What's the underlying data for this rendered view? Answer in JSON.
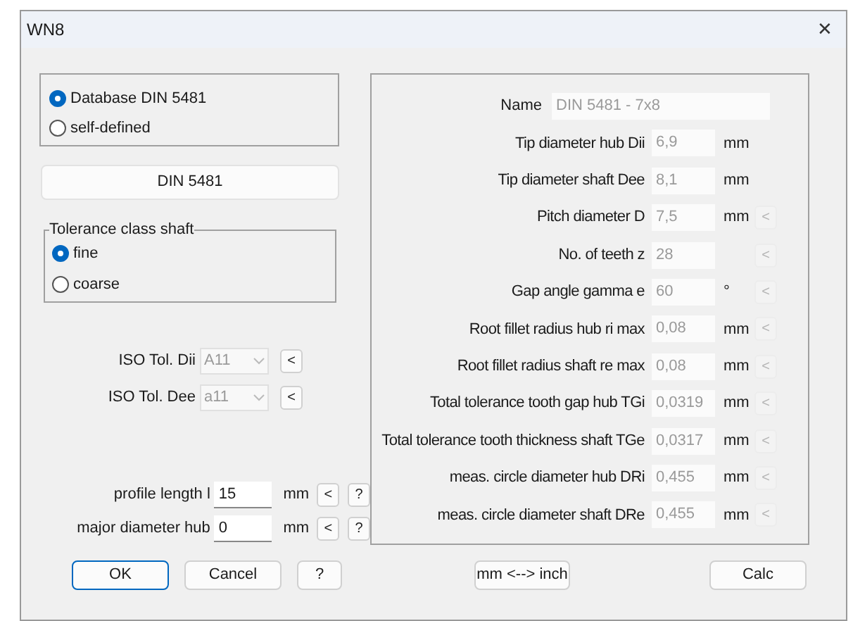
{
  "window": {
    "title": "WN8",
    "close": "✕"
  },
  "source": [
    {
      "label": "Database DIN 5481",
      "selected": true
    },
    {
      "label": "self-defined",
      "selected": false
    }
  ],
  "standard_button": "DIN 5481",
  "tolerance_class": {
    "title": "Tolerance class shaft",
    "options": [
      {
        "label": "fine",
        "selected": true
      },
      {
        "label": "coarse",
        "selected": false
      }
    ]
  },
  "iso_tolerances": [
    {
      "label": "ISO Tol. Dii",
      "value": "A11",
      "disabled": true,
      "button": "<"
    },
    {
      "label": "ISO Tol. Dee",
      "value": "a11",
      "disabled": true,
      "button": "<"
    }
  ],
  "length_fields": [
    {
      "label": "profile length l",
      "value": "15",
      "unit": "mm",
      "button": "<",
      "help": "?"
    },
    {
      "label": "major diameter hub",
      "value": "0",
      "unit": "mm",
      "button": "<",
      "help": "?"
    }
  ],
  "parameters": [
    {
      "label": "Name",
      "value": "DIN 5481 - 7x8",
      "disabled": true,
      "kind": "wide"
    },
    {
      "label": "Tip diameter hub Dii",
      "value": "6,9",
      "unit": "mm",
      "disabled": true,
      "kind": "field"
    },
    {
      "label": "Tip diameter shaft Dee",
      "value": "8,1",
      "unit": "mm",
      "disabled": true,
      "kind": "field"
    },
    {
      "label": "Pitch diameter D",
      "value": "7,5",
      "unit": "mm",
      "disabled": true,
      "kind": "field",
      "button": "<"
    },
    {
      "label": "No. of teeth z",
      "value": "28",
      "disabled": true,
      "kind": "field",
      "button": "<"
    },
    {
      "label": "Gap angle gamma e",
      "value": "60",
      "unit": "°",
      "disabled": true,
      "kind": "field",
      "button": "<"
    },
    {
      "label": "Root fillet radius hub ri max",
      "value": "0,08",
      "unit": "mm",
      "disabled": true,
      "kind": "field",
      "button": "<"
    },
    {
      "label": "Root fillet radius shaft re max",
      "value": "0,08",
      "unit": "mm",
      "disabled": true,
      "kind": "field",
      "button": "<"
    },
    {
      "label": "Total tolerance tooth gap hub TGi",
      "value": "0,0319",
      "unit": "mm",
      "disabled": true,
      "kind": "field",
      "button": "<"
    },
    {
      "label": "Total tolerance tooth thickness shaft TGe",
      "value": "0,0317",
      "unit": "mm",
      "disabled": true,
      "kind": "field",
      "button": "<"
    },
    {
      "label": "meas. circle diameter hub DRi",
      "value": "0,455",
      "unit": "mm",
      "disabled": true,
      "kind": "field",
      "button": "<"
    },
    {
      "label": "meas. circle diameter shaft DRe",
      "value": "0,455",
      "unit": "mm",
      "disabled": true,
      "kind": "field",
      "button": "<"
    }
  ],
  "buttons": [
    {
      "label": "OK",
      "kind": "default"
    },
    {
      "label": "Cancel",
      "kind": "normal"
    },
    {
      "label": "?",
      "kind": "small"
    },
    {
      "label": "mm <--> inch",
      "kind": "normal"
    },
    {
      "label": "Calc",
      "kind": "normal"
    }
  ]
}
